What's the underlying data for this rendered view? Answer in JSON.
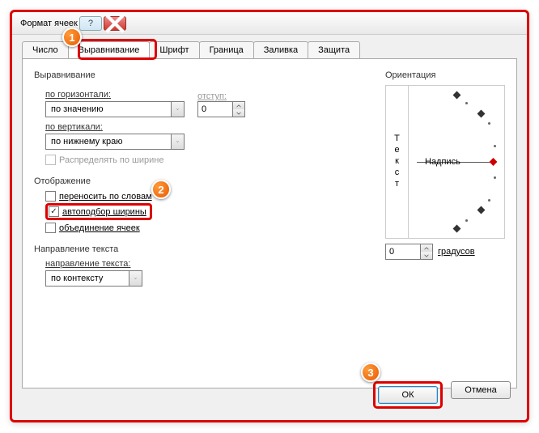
{
  "window": {
    "title": "Формат ячеек"
  },
  "tabs": {
    "number": "Число",
    "alignment": "Выравнивание",
    "font": "Шрифт",
    "border": "Граница",
    "fill": "Заливка",
    "protection": "Защита"
  },
  "alignment": {
    "section": "Выравнивание",
    "horizontal_label": "по горизонтали:",
    "horizontal_value": "по значению",
    "indent_label": "отступ:",
    "indent_value": "0",
    "vertical_label": "по вертикали:",
    "vertical_value": "по нижнему краю",
    "distribute": "Распределять по ширине"
  },
  "display": {
    "section": "Отображение",
    "wrap": "переносить по словам",
    "autofit": "автоподбор ширины",
    "merge": "объединение ячеек"
  },
  "text_direction": {
    "section": "Направление текста",
    "label": "направление текста:",
    "value": "по контексту"
  },
  "orientation": {
    "section": "Ориентация",
    "vertical_text": "Текст",
    "label": "Надпись",
    "degrees_value": "0",
    "degrees_label": "градусов"
  },
  "buttons": {
    "ok": "ОК",
    "cancel": "Отмена"
  },
  "markers": {
    "m1": "1",
    "m2": "2",
    "m3": "3"
  }
}
